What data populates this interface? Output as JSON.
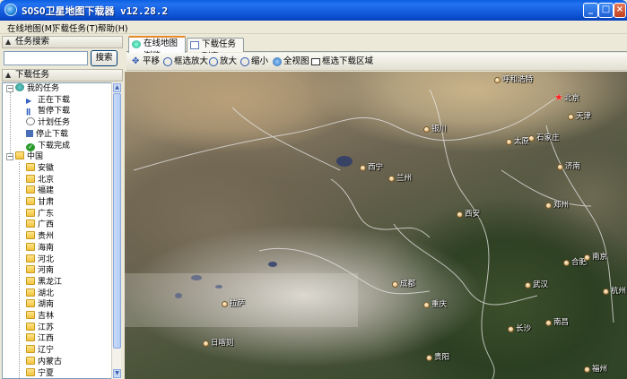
{
  "window": {
    "title": "SOSO卫星地图下载器 v12.28.2",
    "controls": [
      "_",
      "□",
      "×"
    ]
  },
  "menu": [
    "在线地图(M)",
    "下载任务(T)",
    "帮助(H)"
  ],
  "left": {
    "search_header": "任务搜索",
    "search_value": "",
    "search_button": "搜索",
    "tasks_header": "下载任务",
    "my_tasks": "我的任务",
    "task_items": [
      "正在下载",
      "暂停下载",
      "计划任务",
      "停止下载",
      "下载完成"
    ],
    "china": "中国",
    "provinces": [
      "安徽",
      "北京",
      "福建",
      "甘肃",
      "广东",
      "广西",
      "贵州",
      "海南",
      "河北",
      "河南",
      "黑龙江",
      "湖北",
      "湖南",
      "吉林",
      "江苏",
      "江西",
      "辽宁",
      "内蒙古",
      "宁夏"
    ]
  },
  "tabs": [
    "在线地图浏览",
    "下载任务列表"
  ],
  "toolbar": [
    "平移",
    "框选放大",
    "放大",
    "缩小",
    "全视图",
    "框选下载区域"
  ],
  "map": {
    "cities": [
      "呼和浩特",
      "北京",
      "天津",
      "银川",
      "太原",
      "石家庄",
      "西宁",
      "兰州",
      "济南",
      "郑州",
      "西安",
      "合肥",
      "南京",
      "成都",
      "武汉",
      "杭州",
      "重庆",
      "拉萨",
      "长沙",
      "南昌",
      "拉萨",
      "贵阳",
      "福州"
    ],
    "labels": {
      "hohhot": "呼和浩特",
      "beijing": "北京",
      "tianjin": "天津",
      "yinchuan": "银川",
      "taiyuan": "太原",
      "shijiazhuang": "石家庄",
      "xining": "西宁",
      "lanzhou": "兰州",
      "jinan": "济南",
      "zhengzhou": "郑州",
      "xian": "西安",
      "hefei": "合肥",
      "nanjing": "南京",
      "chengdu": "成都",
      "wuhan": "武汉",
      "hangzhou": "杭州",
      "chongqing": "重庆",
      "lhasa": "拉萨",
      "changsha": "长沙",
      "nanchang": "南昌",
      "shigatse": "日喀则",
      "guiyang": "贵阳",
      "fuzhou": "福州"
    }
  },
  "colors": {
    "title_bar": "#0a5fe0",
    "accent_tab": "#e68b2c",
    "capital_star": "#ff2020"
  }
}
